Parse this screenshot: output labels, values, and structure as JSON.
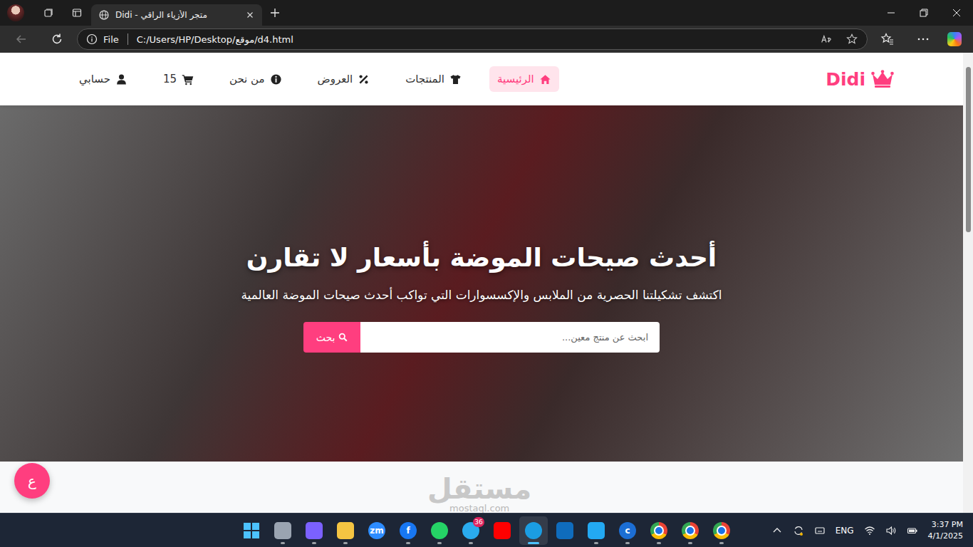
{
  "browser": {
    "tab": {
      "title": "متجر الأزياء الراقي - Didi",
      "selected": true
    },
    "address_bar": {
      "scheme": "File",
      "url": "C:/Users/HP/Desktop/موقع/d4.html",
      "back_disabled": true
    }
  },
  "site": {
    "logo": "Didi",
    "nav": [
      {
        "label": "الرئيسية",
        "kind": "home",
        "selected": true
      },
      {
        "label": "المنتجات",
        "kind": "shirt",
        "selected": false
      },
      {
        "label": "العروض",
        "kind": "percent",
        "selected": false
      },
      {
        "label": "من نحن",
        "kind": "info",
        "selected": false
      },
      {
        "label": "15",
        "kind": "cart",
        "selected": false
      },
      {
        "label": "حسابي",
        "kind": "user",
        "selected": false
      }
    ],
    "hero": {
      "title": "أحدث صيحات الموضة بأسعار لا تقارن",
      "subtitle": "اكتشف تشكيلتنا الحصرية من الملابس والإكسسوارات التي تواكب أحدث صيحات الموضة العالمية",
      "search": {
        "placeholder": "ابحث عن منتج معين...",
        "button": "بحث"
      }
    },
    "chat_button": "ع",
    "watermark": {
      "brand": "مستقل",
      "domain": "mostaql.com"
    }
  },
  "taskbar": {
    "apps": [
      {
        "kind": "windows",
        "color": "#4cc2ff",
        "label": "",
        "badge": "",
        "running": false,
        "selected": false
      },
      {
        "kind": "tile",
        "color": "#9aa4b1",
        "label": "",
        "badge": "",
        "running": true,
        "selected": false
      },
      {
        "kind": "tile",
        "color": "#7b61ff",
        "label": "",
        "badge": "",
        "running": true,
        "selected": false
      },
      {
        "kind": "tile",
        "color": "#f5c542",
        "label": "",
        "badge": "",
        "running": true,
        "selected": false
      },
      {
        "kind": "round",
        "color": "#2d8cff",
        "label": "zm",
        "badge": "",
        "running": false,
        "selected": false
      },
      {
        "kind": "round",
        "color": "#1877f2",
        "label": "f",
        "badge": "",
        "running": true,
        "selected": false
      },
      {
        "kind": "round",
        "color": "#25d366",
        "label": "",
        "badge": "",
        "running": true,
        "selected": false
      },
      {
        "kind": "round",
        "color": "#2aabee",
        "label": "",
        "badge": "36",
        "running": true,
        "selected": false
      },
      {
        "kind": "tile",
        "color": "#ff0000",
        "label": "",
        "badge": "",
        "running": false,
        "selected": false
      },
      {
        "kind": "round",
        "color": "#1b9de2",
        "label": "",
        "badge": "",
        "running": true,
        "selected": true
      },
      {
        "kind": "tile",
        "color": "#0f6cbd",
        "label": "",
        "badge": "",
        "running": false,
        "selected": false
      },
      {
        "kind": "tile",
        "color": "#23a9f2",
        "label": "",
        "badge": "",
        "running": true,
        "selected": false
      },
      {
        "kind": "round",
        "color": "#1c6ed4",
        "label": "c",
        "badge": "",
        "running": true,
        "selected": false
      },
      {
        "kind": "chrome",
        "color": "#1a73e8",
        "label": "",
        "badge": "",
        "running": true,
        "selected": false
      },
      {
        "kind": "chrome",
        "color": "#1a73e8",
        "label": "",
        "badge": "",
        "running": true,
        "selected": false
      },
      {
        "kind": "chrome",
        "color": "#1a73e8",
        "label": "",
        "badge": "",
        "running": true,
        "selected": false
      }
    ],
    "tray": {
      "language": "ENG",
      "time": "3:37 PM",
      "date": "4/1/2025"
    }
  }
}
